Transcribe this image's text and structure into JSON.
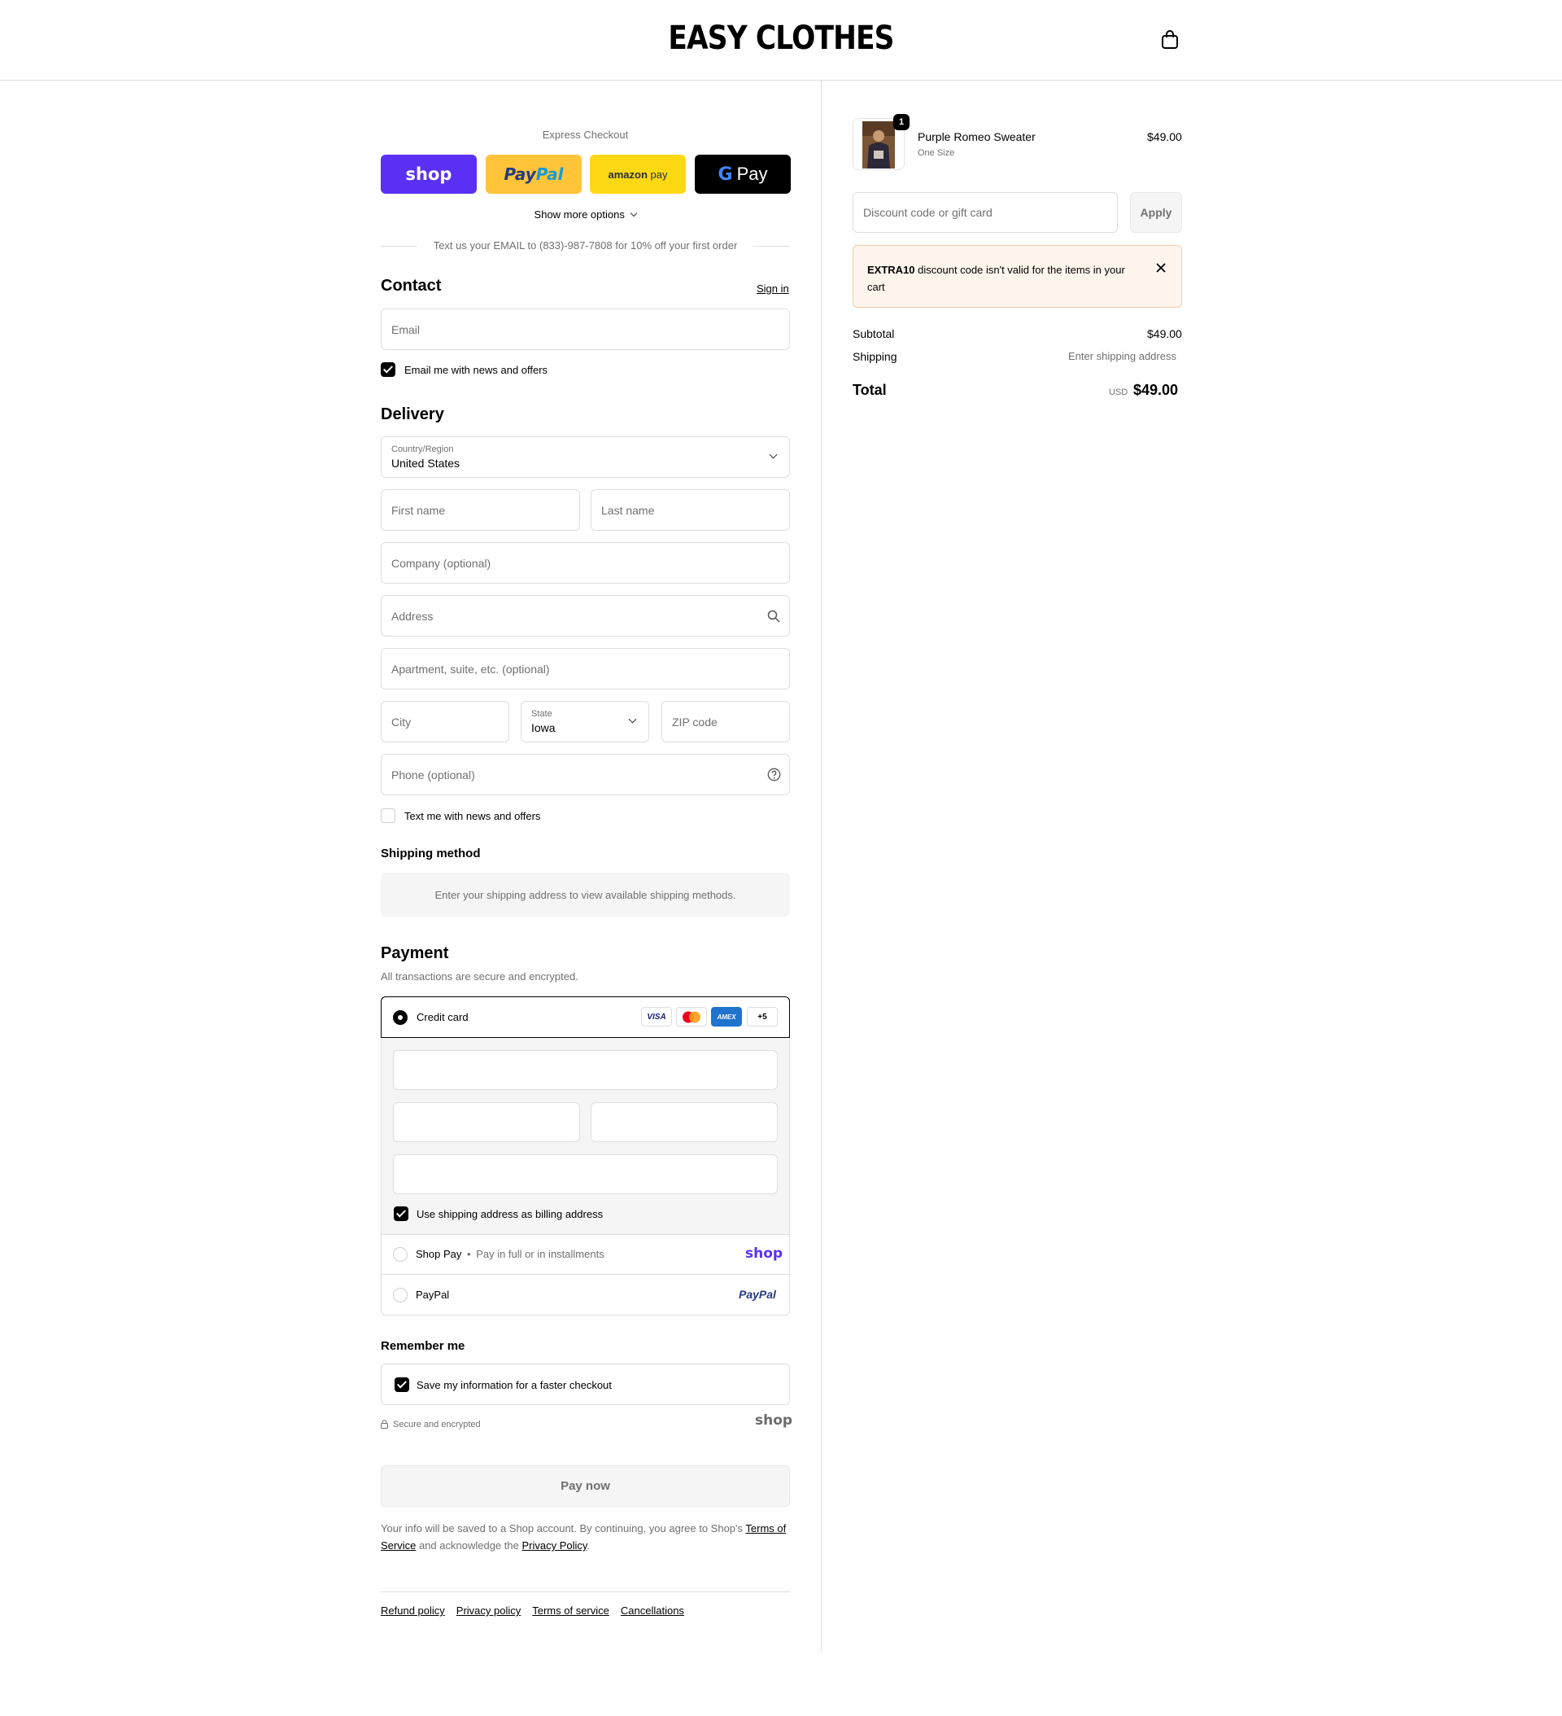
{
  "header": {
    "logo": "EASY CLOTHES",
    "cart_icon": "shopping-bag-icon"
  },
  "express": {
    "title": "Express Checkout",
    "buttons": {
      "shop": "shop",
      "paypal_a": "Pay",
      "paypal_b": "Pal",
      "amazon_a": "amazon",
      "amazon_b": "pay",
      "gpay": "Pay"
    },
    "colors": {
      "shop": "#5a31f4",
      "paypal": "#ffc439",
      "amazon": "#ffd814",
      "gpay": "#000000"
    },
    "more": "Show more options",
    "promo": "Text us your EMAIL to (833)-987-7808 for 10% off your first order"
  },
  "contact": {
    "title": "Contact",
    "sign_in": "Sign in",
    "email_placeholder": "Email",
    "newsletter": "Email me with news and offers"
  },
  "delivery": {
    "title": "Delivery",
    "country_label": "Country/Region",
    "country": "United States",
    "first_name": "First name",
    "last_name": "Last name",
    "company": "Company (optional)",
    "address": "Address",
    "apartment": "Apartment, suite, etc. (optional)",
    "city": "City",
    "state_label": "State",
    "state": "Iowa",
    "zip": "ZIP code",
    "phone": "Phone (optional)",
    "text_offers": "Text me with news and offers"
  },
  "shipping": {
    "title": "Shipping method",
    "notice": "Enter your shipping address to view available shipping methods."
  },
  "payment": {
    "title": "Payment",
    "subtitle": "All transactions are secure and encrypted.",
    "credit_card": "Credit card",
    "brands": [
      "VISA",
      "AMEX",
      "+5"
    ],
    "billing_same": "Use shipping address as billing address",
    "shop_pay": "Shop Pay",
    "shop_pay_desc": "Pay in full or in installments",
    "shop_logo": "shop",
    "paypal": "PayPal",
    "paypal_logo": "PayPal"
  },
  "remember": {
    "title": "Remember me",
    "save": "Save my information for a faster checkout",
    "secure": "Secure and encrypted",
    "shop_logo": "shop"
  },
  "pay_now": "Pay now",
  "legal": {
    "text1": "Your info will be saved to a Shop account. By continuing, you agree to Shop's ",
    "terms": "Terms of Service",
    "text2": " and acknowledge the ",
    "privacy": "Privacy Policy",
    "text3": "."
  },
  "footer_links": [
    "Refund policy",
    "Privacy policy",
    "Terms of service",
    "Cancellations"
  ],
  "summary": {
    "item": {
      "name": "Purple Romeo Sweater",
      "variant": "One Size",
      "price": "$49.00",
      "qty": "1"
    },
    "discount_placeholder": "Discount code or gift card",
    "apply": "Apply",
    "error_code": "EXTRA10",
    "error_text": " discount code isn't valid for the items in your cart",
    "subtotal_label": "Subtotal",
    "subtotal": "$49.00",
    "shipping_label": "Shipping",
    "shipping": "Enter shipping address",
    "total_label": "Total",
    "currency": "USD",
    "total": "$49.00"
  }
}
